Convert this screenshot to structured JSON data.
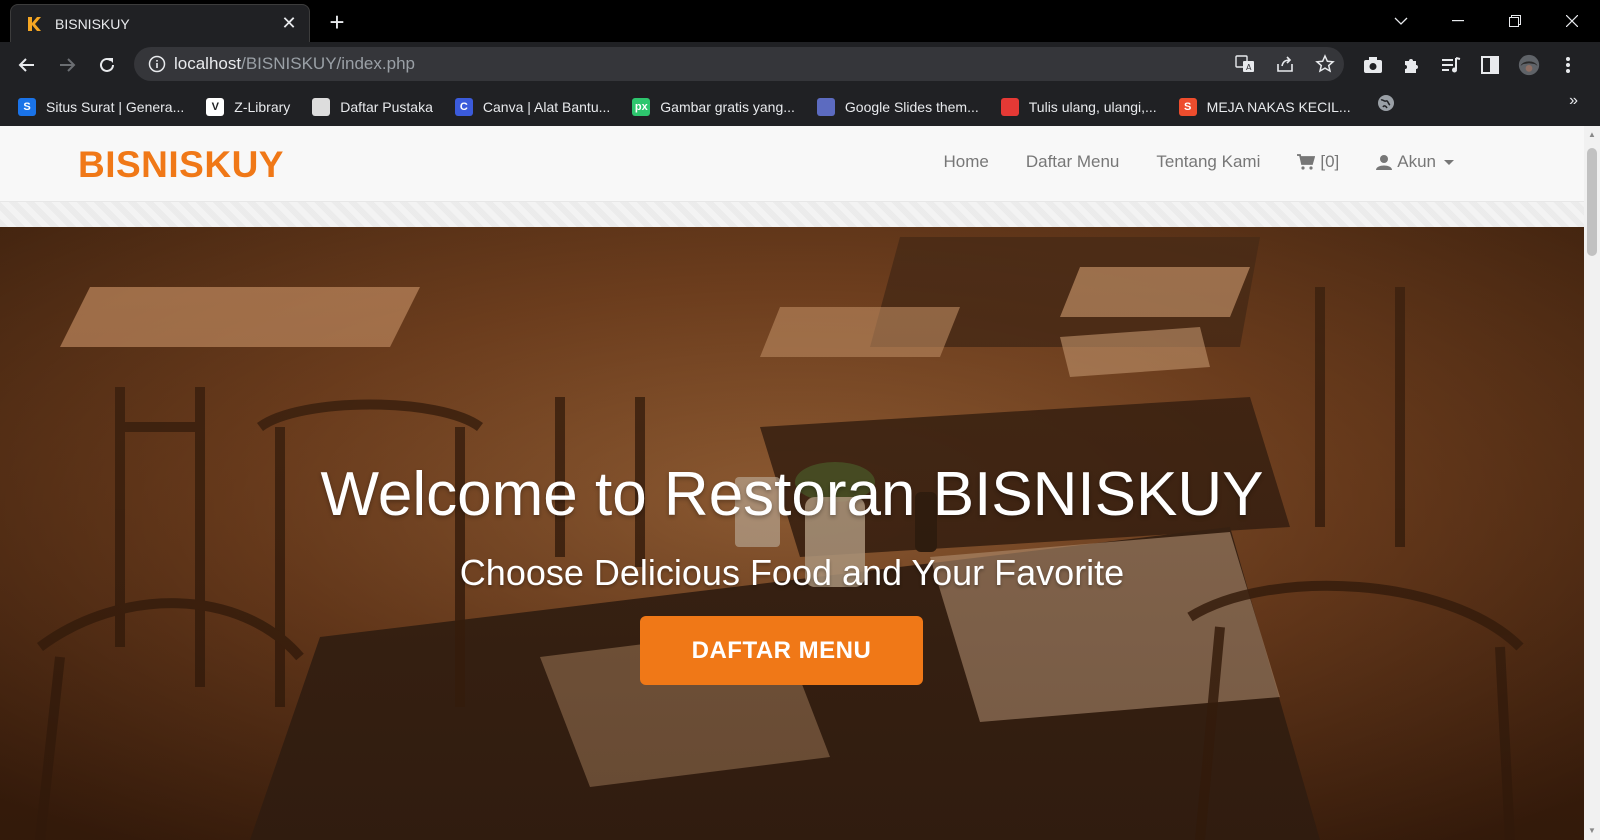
{
  "browser": {
    "tab_title": "BISNISKUY",
    "url_host": "localhost",
    "url_path": "/BISNISKUY/index.php",
    "bookmarks": [
      {
        "label": "Situs Surat | Genera...",
        "icon": "s-icon",
        "color": "#1a73e8",
        "glyph": "S"
      },
      {
        "label": "Z-Library",
        "icon": "zlibrary-icon",
        "color": "#ffffff",
        "glyph": "V"
      },
      {
        "label": "Daftar Pustaka",
        "icon": "book-icon",
        "color": "#dddddd",
        "glyph": ""
      },
      {
        "label": "Canva | Alat Bantu...",
        "icon": "canva-icon",
        "color": "#3b5bdb",
        "glyph": "C"
      },
      {
        "label": "Gambar gratis yang...",
        "icon": "pixabay-icon",
        "color": "#2ec66e",
        "glyph": "px"
      },
      {
        "label": "Google Slides them...",
        "icon": "slides-icon",
        "color": "#5c6bc0",
        "glyph": ""
      },
      {
        "label": "Tulis ulang, ulangi,...",
        "icon": "quillbot-icon",
        "color": "#e53935",
        "glyph": ""
      },
      {
        "label": "MEJA NAKAS KECIL...",
        "icon": "shopee-icon",
        "color": "#ee4d2d",
        "glyph": "S"
      }
    ]
  },
  "page": {
    "brand": "BISNISKUY",
    "accent_color": "#f07817",
    "nav": {
      "home": "Home",
      "menu": "Daftar Menu",
      "about": "Tentang Kami",
      "cart": "[0]",
      "account": "Akun"
    },
    "hero": {
      "title": "Welcome to Restoran BISNISKUY",
      "subtitle": "Choose Delicious Food and Your Favorite",
      "cta": "DAFTAR MENU"
    }
  }
}
